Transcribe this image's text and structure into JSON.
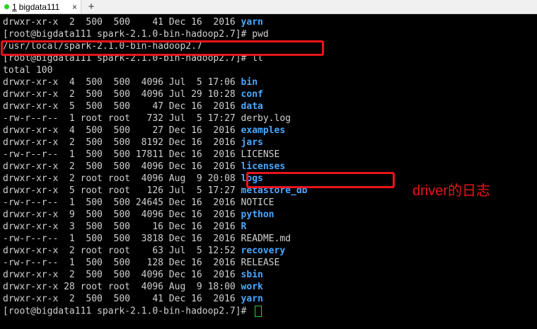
{
  "tab": {
    "number": "1",
    "title": "bigdata111",
    "close": "×",
    "add": "+",
    "status_color": "#1fd61f"
  },
  "colors": {
    "directory": "#4aa8ff",
    "highlight": "#e8141b",
    "text": "#d0d0d0",
    "cursor": "#2ecc40"
  },
  "terminal": {
    "lines": [
      {
        "text": "drwxr-xr-x  2  500  500    41 Dec 16  2016 ",
        "dir": "yarn"
      },
      {
        "text": "[root@bigdata111 spark-2.1.0-bin-hadoop2.7]# pwd"
      },
      {
        "text": "/usr/local/spark-2.1.0-bin-hadoop2.7"
      },
      {
        "text": "[root@bigdata111 spark-2.1.0-bin-hadoop2.7]# ll"
      },
      {
        "text": "total 100"
      },
      {
        "text": "drwxr-xr-x  4  500  500  4096 Jul  5 17:06 ",
        "dir": "bin"
      },
      {
        "text": "drwxr-xr-x  2  500  500  4096 Jul 29 10:28 ",
        "dir": "conf"
      },
      {
        "text": "drwxr-xr-x  5  500  500    47 Dec 16  2016 ",
        "dir": "data"
      },
      {
        "text": "-rw-r--r--  1 root root   732 Jul  5 17:27 derby.log"
      },
      {
        "text": "drwxr-xr-x  4  500  500    27 Dec 16  2016 ",
        "dir": "examples"
      },
      {
        "text": "drwxr-xr-x  2  500  500  8192 Dec 16  2016 ",
        "dir": "jars"
      },
      {
        "text": "-rw-r--r--  1  500  500 17811 Dec 16  2016 LICENSE"
      },
      {
        "text": "drwxr-xr-x  2  500  500  4096 Dec 16  2016 ",
        "dir": "licenses"
      },
      {
        "text": "drwxr-xr-x  2 root root  4096 Aug  9 20:08 ",
        "dir": "logs"
      },
      {
        "text": "drwxr-xr-x  5 root root   126 Jul  5 17:27 ",
        "dir": "metastore_db"
      },
      {
        "text": "-rw-r--r--  1  500  500 24645 Dec 16  2016 NOTICE"
      },
      {
        "text": "drwxr-xr-x  9  500  500  4096 Dec 16  2016 ",
        "dir": "python"
      },
      {
        "text": "drwxr-xr-x  3  500  500    16 Dec 16  2016 ",
        "dir": "R"
      },
      {
        "text": "-rw-r--r--  1  500  500  3818 Dec 16  2016 README.md"
      },
      {
        "text": "drwxr-xr-x  2 root root    63 Jul  5 12:52 ",
        "dir": "recovery"
      },
      {
        "text": "-rw-r--r--  1  500  500   128 Dec 16  2016 RELEASE"
      },
      {
        "text": "drwxr-xr-x  2  500  500  4096 Dec 16  2016 ",
        "dir": "sbin"
      },
      {
        "text": "drwxr-xr-x 28 root root  4096 Aug  9 18:00 ",
        "dir": "work"
      },
      {
        "text": "drwxr-xr-x  2  500  500    41 Dec 16  2016 ",
        "dir": "yarn"
      },
      {
        "text": "[root@bigdata111 spark-2.1.0-bin-hadoop2.7]# ",
        "cursor": true
      }
    ]
  },
  "annotation": {
    "text": "driver的日志",
    "color": "#e8141b"
  }
}
